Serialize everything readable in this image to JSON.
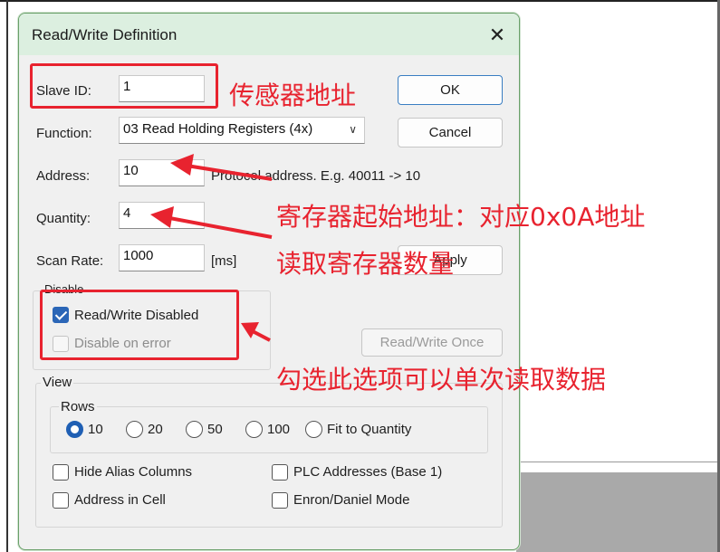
{
  "dialog": {
    "title": "Read/Write Definition",
    "close_glyph": "✕",
    "slave_id": {
      "label": "Slave ID:",
      "value": "1"
    },
    "function": {
      "label": "Function:",
      "value": "03 Read Holding Registers (4x)"
    },
    "address": {
      "label": "Address:",
      "value": "10",
      "hint": "Protocol address. E.g. 40011 -> 10"
    },
    "quantity": {
      "label": "Quantity:",
      "value": "4"
    },
    "scan_rate": {
      "label": "Scan Rate:",
      "value": "1000",
      "unit": "[ms]"
    },
    "buttons": {
      "ok": "OK",
      "cancel": "Cancel",
      "apply": "Apply",
      "read_write_once": "Read/Write Once"
    },
    "disable_group": {
      "title": "Disable",
      "read_write_disabled": {
        "label": "Read/Write Disabled",
        "checked": true
      },
      "disable_on_error": {
        "label": "Disable on error",
        "checked": false,
        "enabled": false
      }
    },
    "view_group": {
      "title": "View",
      "rows_group": {
        "title": "Rows",
        "options": [
          "10",
          "20",
          "50",
          "100",
          "Fit to Quantity"
        ],
        "selected": "10"
      },
      "hide_alias_columns": {
        "label": "Hide Alias Columns",
        "checked": false
      },
      "plc_addresses": {
        "label": "PLC Addresses (Base 1)",
        "checked": false
      },
      "address_in_cell": {
        "label": "Address in Cell",
        "checked": false
      },
      "enron_daniel_mode": {
        "label": "Enron/Daniel Mode",
        "checked": false
      }
    }
  },
  "annotations": {
    "sensor_address": "传感器地址",
    "register_start": "寄存器起始地址：对应0x0A地址",
    "register_count": "读取寄存器数量",
    "single_read": "勾选此选项可以单次读取数据",
    "color": "#e8232f"
  },
  "colors": {
    "accent": "#2b66b7",
    "titlebar": "#dcefe0",
    "annotation": "#e8232f"
  }
}
